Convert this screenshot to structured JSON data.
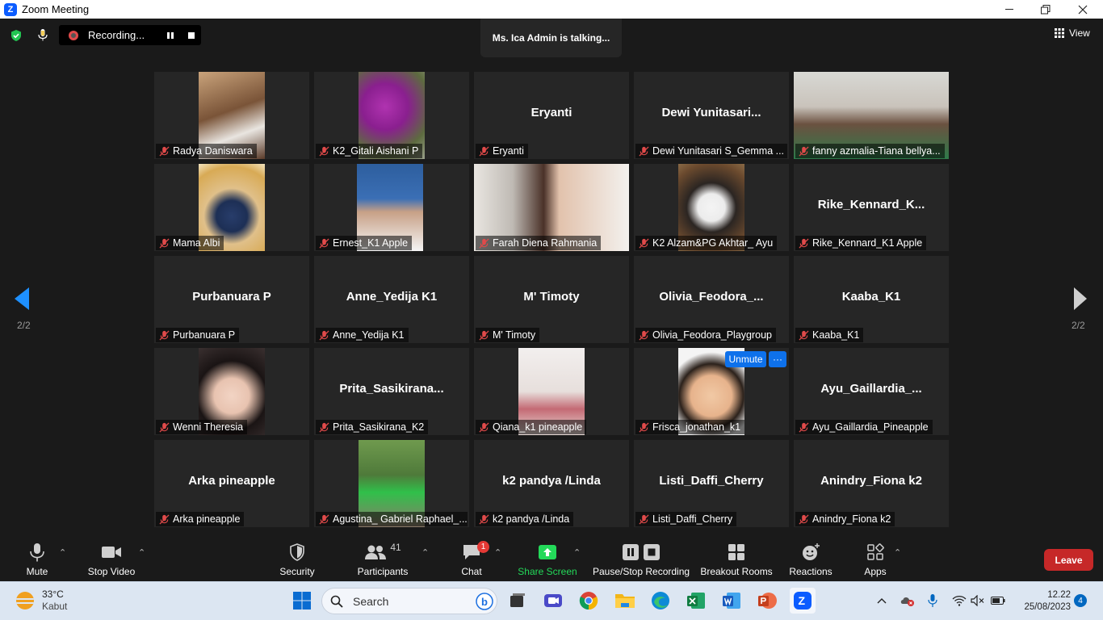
{
  "window": {
    "title": "Zoom Meeting"
  },
  "topbar": {
    "recording_label": "Recording...",
    "talking": "Ms. Ica Admin is talking...",
    "view_label": "View"
  },
  "pagination": {
    "left": "2/2",
    "right": "2/2"
  },
  "tiles": [
    {
      "name": "Radya Daniswara",
      "video": true
    },
    {
      "name": "K2_Gitali Aishani P",
      "video": true
    },
    {
      "name": "Eryanti",
      "big": "Eryanti",
      "video": false
    },
    {
      "name": "Dewi Yunitasari S_Gemma ...",
      "big": "Dewi  Yunitasari...",
      "video": false
    },
    {
      "name": "fanny azmalia-Tiana bellya...",
      "video": true
    },
    {
      "name": "Mama Albi",
      "video": true
    },
    {
      "name": "Ernest_K1 Apple",
      "video": true
    },
    {
      "name": "Farah Diena Rahmania",
      "video": true
    },
    {
      "name": "K2 Alzam&PG Akhtar_ Ayu",
      "video": true
    },
    {
      "name": "Rike_Kennard_K1 Apple",
      "big": "Rike_Kennard_K...",
      "video": false
    },
    {
      "name": "Purbanuara P",
      "big": "Purbanuara P",
      "video": false
    },
    {
      "name": "Anne_Yedija K1",
      "big": "Anne_Yedija K1",
      "video": false
    },
    {
      "name": "M' Timoty",
      "big": "M' Timoty",
      "video": false
    },
    {
      "name": "Olivia_Feodora_Playgroup",
      "big": "Olivia_Feodora_...",
      "video": false
    },
    {
      "name": "Kaaba_K1",
      "big": "Kaaba_K1",
      "video": false
    },
    {
      "name": "Wenni Theresia",
      "video": true
    },
    {
      "name": "Prita_Sasikirana_K2",
      "big": "Prita_Sasikirana...",
      "video": false
    },
    {
      "name": "Qiana_k1 pineapple",
      "video": true
    },
    {
      "name": "Frisca_jonathan_k1",
      "video": true
    },
    {
      "name": "Ayu_Gaillardia_Pineapple",
      "big": "Ayu_Gaillardia_...",
      "video": false
    },
    {
      "name": "Arka pineapple",
      "big": "Arka pineapple",
      "video": false
    },
    {
      "name": "Agustina_ Gabriel Raphael_...",
      "video": true
    },
    {
      "name": "k2 pandya /Linda",
      "big": "k2 pandya /Linda",
      "video": false
    },
    {
      "name": "Listi_Daffi_Cherry",
      "big": "Listi_Daffi_Cherry",
      "video": false
    },
    {
      "name": "Anindry_Fiona k2",
      "big": "Anindry_Fiona k2",
      "video": false
    }
  ],
  "hover_controls": {
    "unmute": "Unmute",
    "more": "···"
  },
  "toolbar": {
    "mute": "Mute",
    "stop_video": "Stop Video",
    "security": "Security",
    "participants": "Participants",
    "participants_count": "41",
    "chat": "Chat",
    "chat_badge": "1",
    "share_screen": "Share Screen",
    "pause_stop_recording": "Pause/Stop Recording",
    "breakout_rooms": "Breakout Rooms",
    "reactions": "Reactions",
    "apps": "Apps",
    "leave": "Leave"
  },
  "taskbar": {
    "temperature": "33°C",
    "weather": "Kabut",
    "search_placeholder": "Search",
    "time": "12.22",
    "date": "25/08/2023",
    "notification_count": "4"
  },
  "colors": {
    "accent": "#0e71eb",
    "leave": "#c62828",
    "share": "#23d959",
    "mute_icon": "#e04a4a"
  }
}
